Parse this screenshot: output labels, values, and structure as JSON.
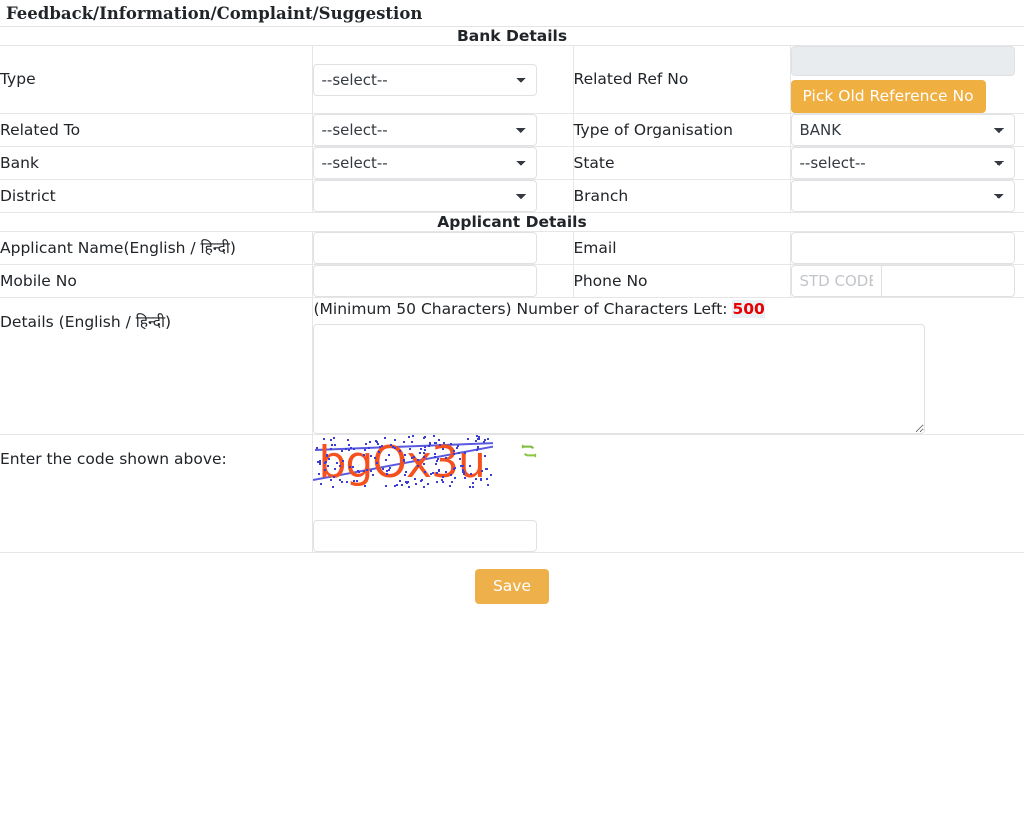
{
  "page": {
    "title": "Feedback/Information/Complaint/Suggestion"
  },
  "sections": {
    "bank_details_heading": "Bank Details",
    "applicant_details_heading": "Applicant Details"
  },
  "bank_details": {
    "type_label": "Type",
    "type_value": "--select--",
    "related_ref_no_label": "Related Ref No",
    "related_ref_no_value": "",
    "pick_old_reference_button": "Pick Old Reference No",
    "related_to_label": "Related To",
    "related_to_value": "--select--",
    "type_of_organisation_label": "Type of Organisation",
    "type_of_organisation_value": "BANK",
    "bank_label": "Bank",
    "bank_value": "--select--",
    "state_label": "State",
    "state_value": "--select--",
    "district_label": "District",
    "district_value": "",
    "branch_label": "Branch",
    "branch_value": ""
  },
  "applicant_details": {
    "applicant_name_label": "Applicant Name(English / हिन्दी)",
    "applicant_name_value": "",
    "email_label": "Email",
    "email_value": "",
    "mobile_no_label": "Mobile No",
    "mobile_no_value": "",
    "phone_no_label": "Phone No",
    "std_code_placeholder": "STD CODE",
    "std_code_value": "",
    "phone_no_value": "",
    "details_label": "Details (English / हिन्दी)",
    "details_note_prefix": "(Minimum 50 Characters) Number of Characters Left: ",
    "details_chars_left": "500",
    "details_value": ""
  },
  "captcha": {
    "label": "Enter the code shown above:",
    "code_text": "bgOx3u",
    "refresh_icon": "refresh-icon",
    "input_value": ""
  },
  "footer": {
    "save_label": "Save"
  },
  "colors": {
    "amber": "#efaf41",
    "save": "#eeb04a",
    "captcha_text": "#f4511e",
    "captcha_line": "#5a5ae0",
    "refresh_green": "#7fba3c",
    "chars_left": "#e80000",
    "disabled_bg": "#e9ecef",
    "border": "#e6e6e6"
  }
}
